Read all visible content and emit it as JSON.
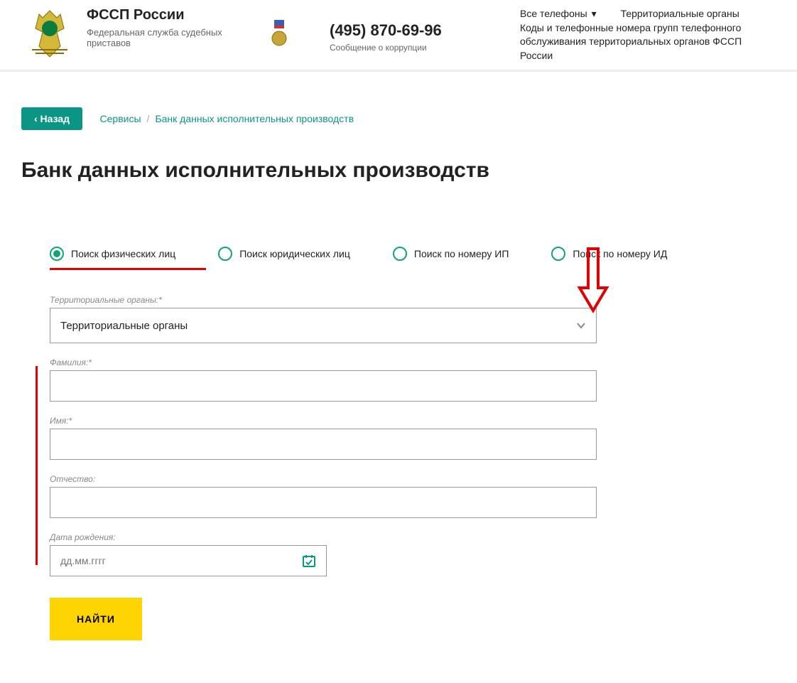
{
  "header": {
    "org_name": "ФССП России",
    "org_subtitle": "Федеральная служба судебных приставов",
    "phone": "(495) 870-69-96",
    "corruption_link": "Сообщение о коррупции",
    "all_phones": "Все телефоны",
    "territorial_link": "Территориальные органы",
    "codes_link": "Коды и телефонные номера групп телефонного обслуживания территориальных органов ФССП России"
  },
  "nav": {
    "back": "‹  Назад",
    "crumb1": "Сервисы",
    "crumb2": "Банк данных исполнительных производств"
  },
  "page_title": "Банк данных исполнительных производств",
  "tabs": {
    "phys": "Поиск физических лиц",
    "jur": "Поиск юридических лиц",
    "ip": "Поиск по номеру ИП",
    "id": "Поиск по номеру ИД"
  },
  "form": {
    "territory_label": "Территориальные органы:*",
    "territory_value": "Территориальные органы",
    "lastname_label": "Фамилия:*",
    "firstname_label": "Имя:*",
    "patronymic_label": "Отчество:",
    "birthdate_label": "Дата рождения:",
    "birthdate_placeholder": "дд.мм.гггг",
    "submit": "НАЙТИ"
  }
}
